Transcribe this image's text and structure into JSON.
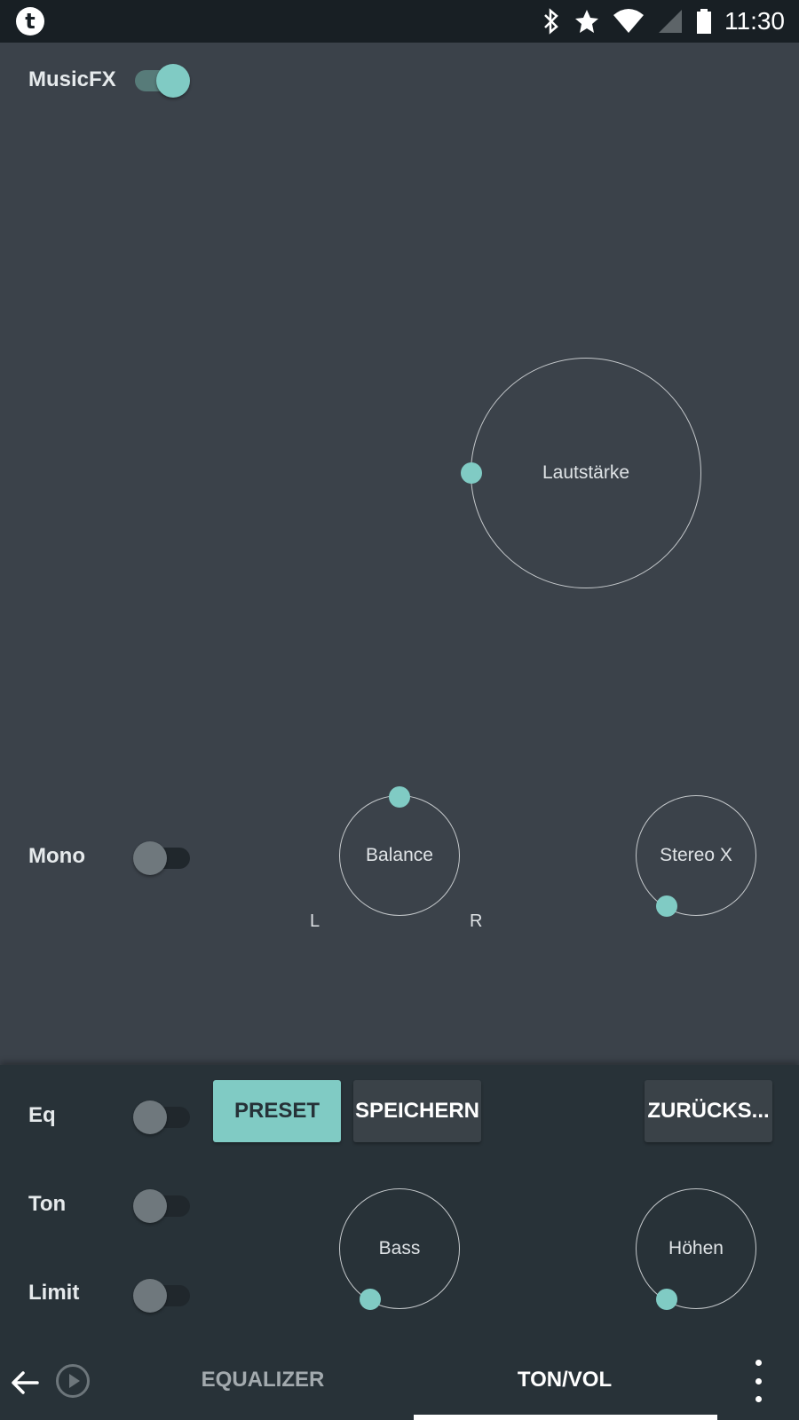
{
  "status_bar": {
    "time": "11:30",
    "app_icon_letter": "t",
    "icons": [
      "bluetooth-icon",
      "star-icon",
      "wifi-icon",
      "signal-icon",
      "battery-icon"
    ]
  },
  "toggles": {
    "musicfx": {
      "label": "MusicFX",
      "on": true
    },
    "mono": {
      "label": "Mono",
      "on": false
    },
    "eq": {
      "label": "Eq",
      "on": false
    },
    "ton": {
      "label": "Ton",
      "on": false
    },
    "limit": {
      "label": "Limit",
      "on": false
    }
  },
  "knobs": {
    "volume": {
      "label": "Lautstärke"
    },
    "balance": {
      "label": "Balance",
      "left_label": "L",
      "right_label": "R"
    },
    "stereo_x": {
      "label": "Stereo X"
    },
    "bass": {
      "label": "Bass"
    },
    "treble": {
      "label": "Höhen"
    }
  },
  "buttons": {
    "preset": "PRESET",
    "save": "SPEICHERN",
    "reset": "ZURÜCKS..."
  },
  "nav": {
    "tabs": [
      {
        "label": "EQUALIZER",
        "active": false
      },
      {
        "label": "TON/VOL",
        "active": true
      }
    ]
  },
  "colors": {
    "accent": "#80cbc4",
    "background": "#3b424a",
    "panel": "#283238",
    "status_bar": "#181f24"
  }
}
